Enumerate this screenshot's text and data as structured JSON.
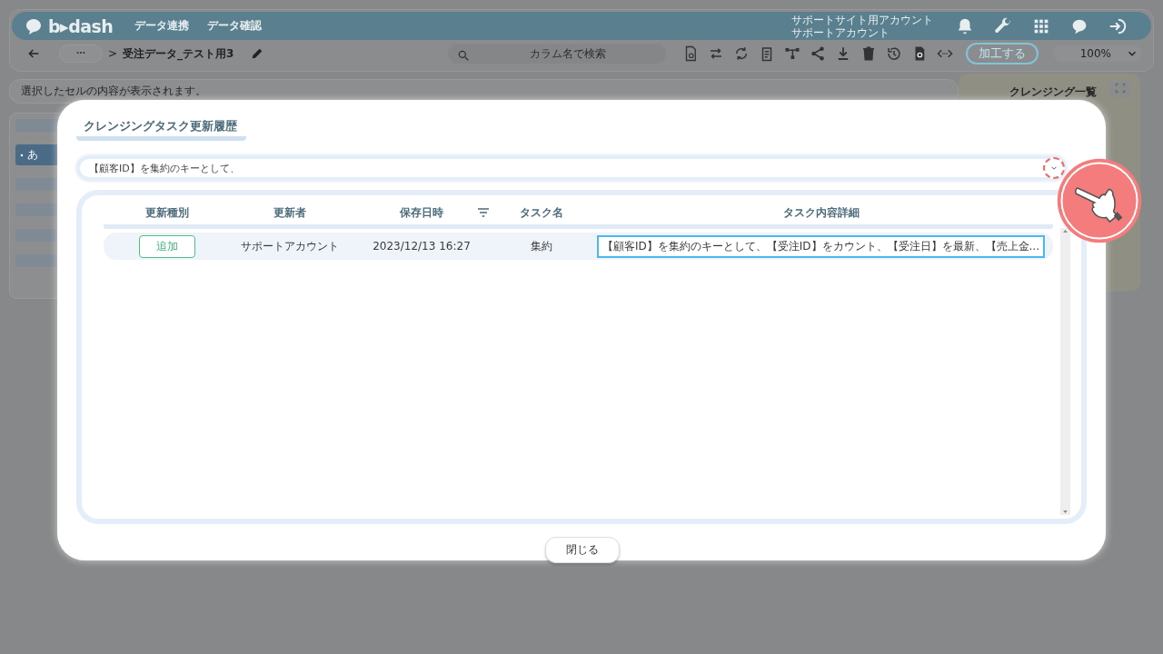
{
  "header": {
    "logo": "b▸dash",
    "nav": [
      "データ連携",
      "データ確認"
    ],
    "account": [
      "サポートサイト用アカウント",
      "サポートアカウント"
    ]
  },
  "toolbar": {
    "breadcrumb_separator": ">",
    "file_name": "受注データ_テスト用3",
    "search": {
      "placeholder": "カラム名で検索"
    },
    "process_button": "加工する",
    "zoom": "100%"
  },
  "cell_info": "選択したセルの内容が表示されます。",
  "left_panel": {
    "item": "あ"
  },
  "right_panel": {
    "title": "クレンジング一覧"
  },
  "modal": {
    "title": "クレンジングタスク更新履歴",
    "task_select": {
      "value": "【顧客ID】を集約のキーとして、"
    },
    "columns": [
      "更新種別",
      "更新者",
      "保存日時",
      "タスク名",
      "タスク内容詳細"
    ],
    "rows": [
      {
        "type": "追加",
        "updater": "サポートアカウント",
        "saved_at": "2023/12/13 16:27",
        "task": "集約",
        "detail": "【顧客ID】を集約のキーとして、【受注ID】をカウント、【受注日】を最新、【売上金...",
        "detail_focused": true
      }
    ],
    "close_button": "閉じる"
  }
}
